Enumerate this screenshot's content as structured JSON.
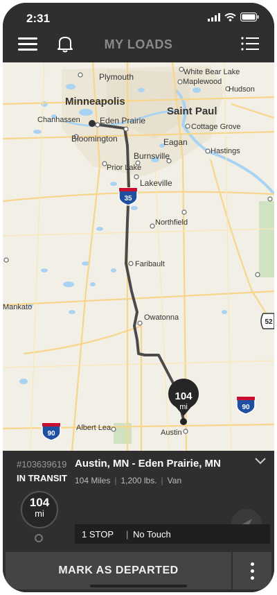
{
  "status_bar": {
    "time": "2:31"
  },
  "nav": {
    "title": "MY LOADS"
  },
  "map": {
    "cities": {
      "plymouth": "Plymouth",
      "white_bear_lake": "White Bear Lake",
      "maplewood": "Maplewood",
      "minneapolis": "Minneapolis",
      "hudson": "Hudson",
      "saint_paul": "Saint Paul",
      "chanhassen": "Chanhassen",
      "eden_prairie": "Eden Prairie",
      "bloomington": "Bloomington",
      "cottage_grove": "Cottage Grove",
      "eagan": "Eagan",
      "burnsville": "Burnsville",
      "hastings": "Hastings",
      "prior_lake": "Prior Lake",
      "lakeville": "Lakeville",
      "northfield": "Northfield",
      "faribault": "Faribault",
      "mankato": "Mankato",
      "owatonna": "Owatonna",
      "albert_lea": "Albert Lea",
      "austin": "Austin"
    },
    "shields": {
      "i35": "35",
      "i90_west": "90",
      "i90_east": "90",
      "us52": "52"
    },
    "distance_pin": {
      "value": "104",
      "unit": "mi"
    }
  },
  "load": {
    "id": "#103639619",
    "status": "IN TRANSIT",
    "route": "Austin, MN - Eden Prairie, MN",
    "miles": "104 Miles",
    "weight": "1,200 lbs.",
    "equipment": "Van",
    "distance": {
      "value": "104",
      "unit": "mi"
    },
    "stops": "1 STOP",
    "handling": "No Touch"
  },
  "actions": {
    "primary": "MARK AS DEPARTED"
  },
  "colors": {
    "bar": "#2f2f2f",
    "route": "#4a4a4a",
    "map_bg": "#f2efe6"
  }
}
